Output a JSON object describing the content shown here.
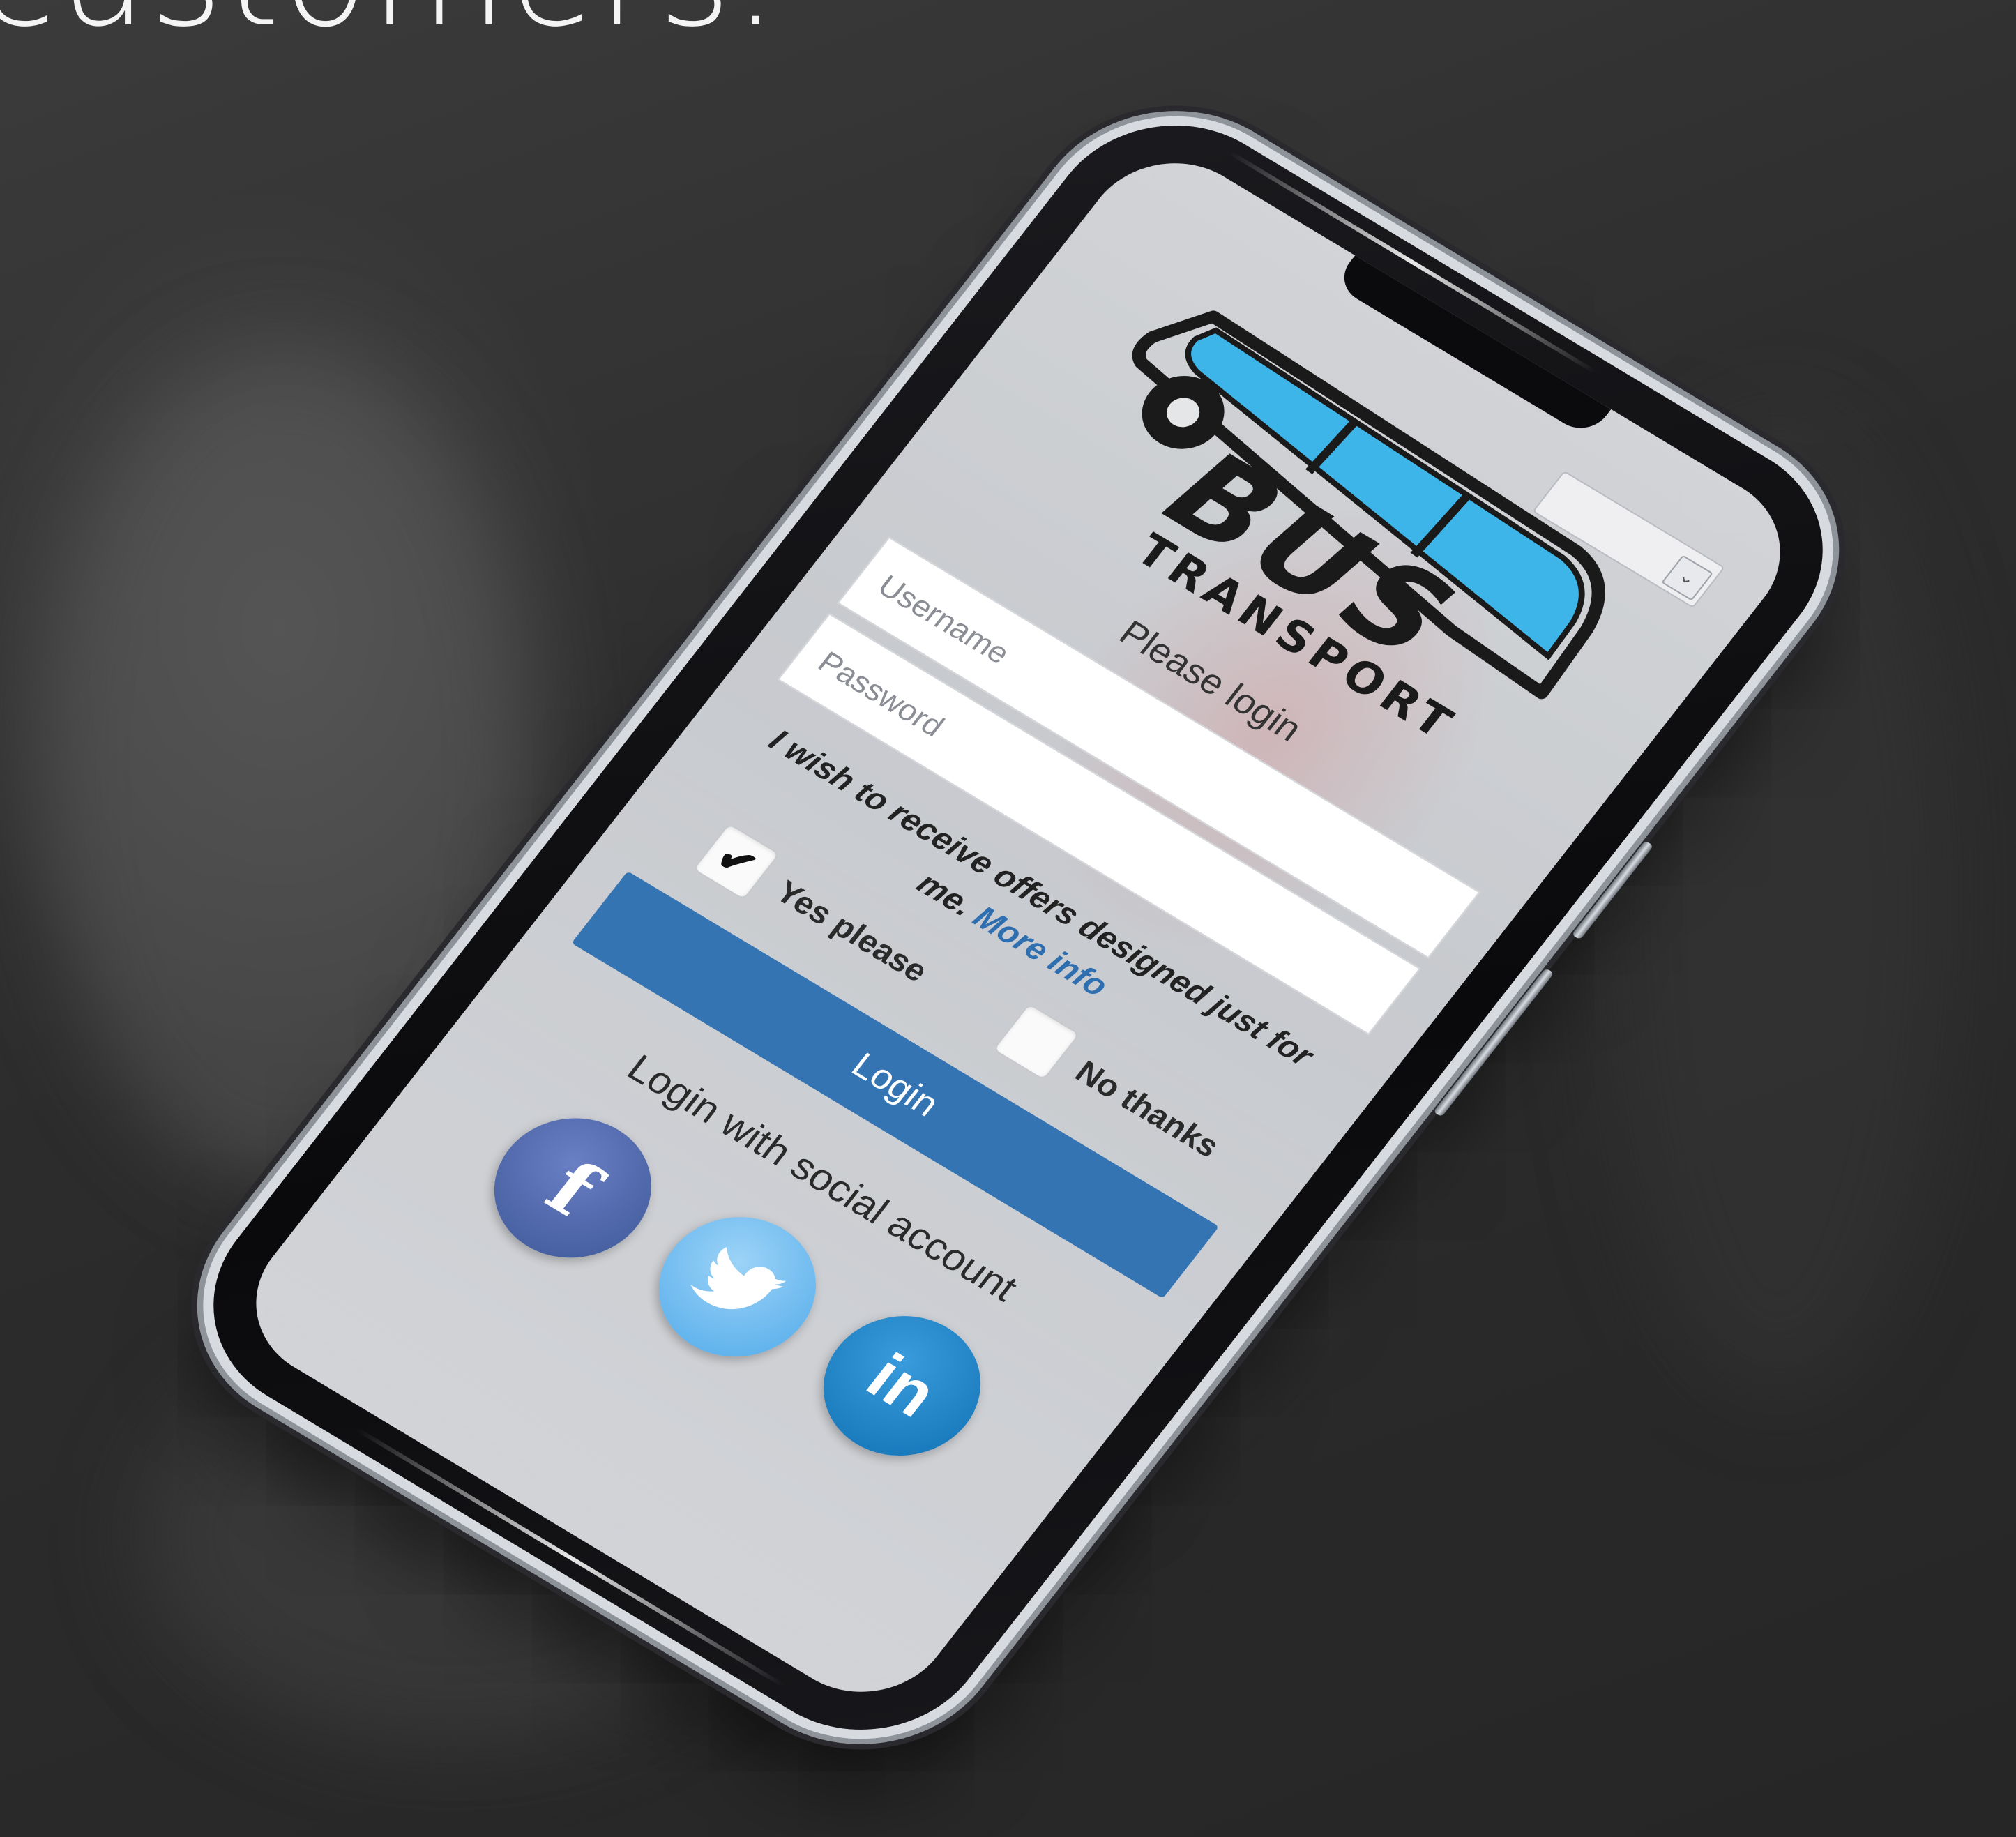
{
  "hero": {
    "heading": "customers."
  },
  "app": {
    "brand_line1": "BUS",
    "brand_line2": "TRANSPORT",
    "prompt": "Please login",
    "username_placeholder": "Username",
    "password_placeholder": "Password",
    "offers_text": "I wish to receive offers designed just for me.",
    "more_info_link": "More info",
    "choice_yes": "Yes please",
    "choice_no": "No thanks",
    "yes_checked_glyph": "✔",
    "login_button": "Login",
    "social_title": "Login with social account",
    "social_buttons": [
      {
        "name": "facebook",
        "glyph": "f",
        "icon": "facebook-icon"
      },
      {
        "name": "twitter",
        "glyph": "",
        "icon": "twitter-icon"
      },
      {
        "name": "linkedin",
        "glyph": "in",
        "icon": "linkedin-icon"
      }
    ],
    "yes_checked": true,
    "no_checked": false
  },
  "colors": {
    "primary_button": "#3474b2",
    "link": "#2f6fb0",
    "logo_blue": "#3db5e8",
    "logo_dark": "#1a1a1a",
    "facebook": "#3b5796",
    "twitter": "#4fa9ea",
    "linkedin": "#0f71b3"
  }
}
